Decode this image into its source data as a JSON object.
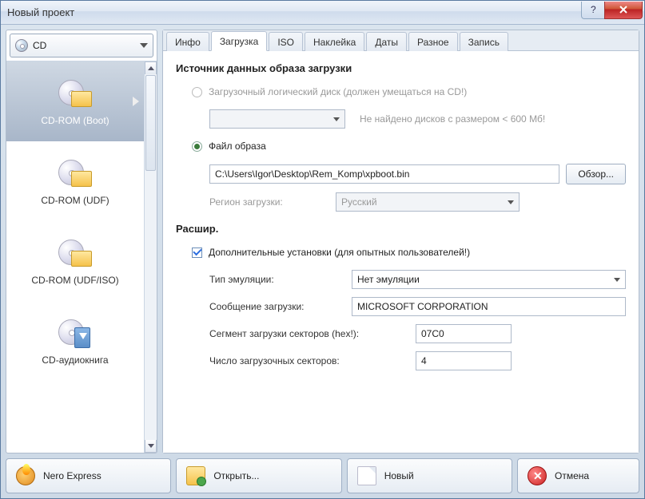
{
  "window": {
    "title": "Новый проект"
  },
  "disc_select": {
    "label": "CD"
  },
  "projects": {
    "items": [
      {
        "label": "CD-ROM (Boot)"
      },
      {
        "label": "CD-ROM (UDF)"
      },
      {
        "label": "CD-ROM (UDF/ISO)"
      },
      {
        "label": "CD-аудиокнига"
      }
    ]
  },
  "tabs": {
    "items": [
      {
        "label": "Инфо"
      },
      {
        "label": "Загрузка"
      },
      {
        "label": "ISO"
      },
      {
        "label": "Наклейка"
      },
      {
        "label": "Даты"
      },
      {
        "label": "Разное"
      },
      {
        "label": "Запись"
      }
    ],
    "active": 1
  },
  "boot": {
    "section_title": "Источник данных образа загрузки",
    "radio_disk_label": "Загрузочный логический диск (должен умещаться на CD!)",
    "no_disks_msg": "Не найдено дисков с размером < 600 Мб!",
    "radio_file_label": "Файл образа",
    "file_path": "C:\\Users\\Igor\\Desktop\\Rem_Komp\\xpboot.bin",
    "browse_btn": "Обзор...",
    "region_label": "Регион загрузки:",
    "region_value": "Русский"
  },
  "adv": {
    "section_title": "Расшир.",
    "check_label": "Дополнительные установки (для опытных пользователей!)",
    "emu_label": "Тип эмуляции:",
    "emu_value": "Нет эмуляции",
    "msg_label": "Сообщение загрузки:",
    "msg_value": "MICROSOFT CORPORATION",
    "seg_label": "Сегмент загрузки секторов (hex!):",
    "seg_value": "07C0",
    "cnt_label": "Число загрузочных секторов:",
    "cnt_value": "4"
  },
  "bottom": {
    "nero": "Nero Express",
    "open": "Открыть...",
    "new": "Новый",
    "cancel": "Отмена"
  }
}
